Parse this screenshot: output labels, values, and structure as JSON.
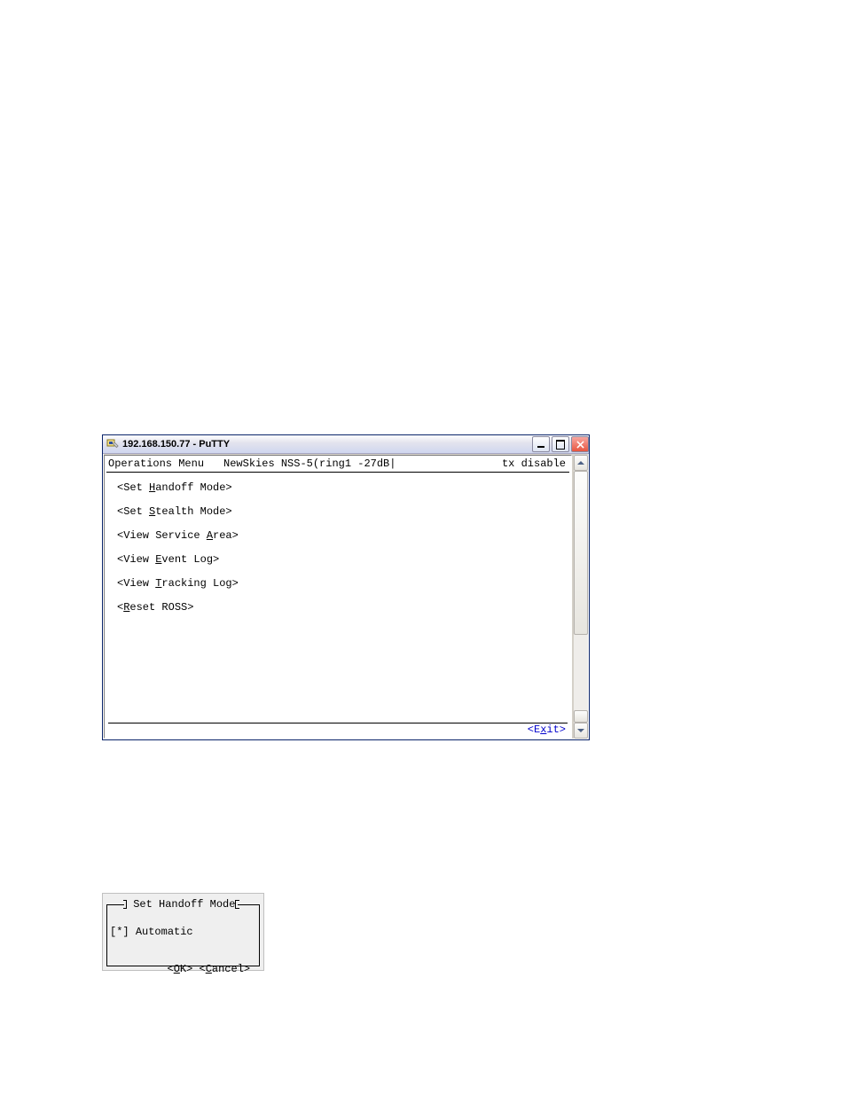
{
  "putty": {
    "title": "192.168.150.77 - PuTTY",
    "header": {
      "left": "Operations Menu",
      "mid": "NewSkies NSS-5(ring1 -27dB|",
      "right": "tx disable"
    },
    "menu": {
      "handoff_pre": "<Set ",
      "handoff_u": "H",
      "handoff_post": "andoff Mode>",
      "stealth_pre": "<Set ",
      "stealth_u": "S",
      "stealth_post": "tealth Mode>",
      "area_pre": "<View Service ",
      "area_u": "A",
      "area_post": "rea>",
      "event_pre": "<View ",
      "event_u": "E",
      "event_post": "vent Log>",
      "track_pre": "<View ",
      "track_u": "T",
      "track_post": "racking Log>",
      "reset_pre": "<",
      "reset_u": "R",
      "reset_post": "eset ROSS>"
    },
    "footer": {
      "exit_pre": "<E",
      "exit_u": "x",
      "exit_post": "it>"
    }
  },
  "dialog": {
    "title": " Set Handoff Mode",
    "check_pre": "[*] ",
    "check_label": "Automatic",
    "ok_pre": "<",
    "ok_u": "O",
    "ok_post": "K>",
    "gap": " ",
    "cancel_pre": "<",
    "cancel_u": "C",
    "cancel_post": "ancel>"
  }
}
